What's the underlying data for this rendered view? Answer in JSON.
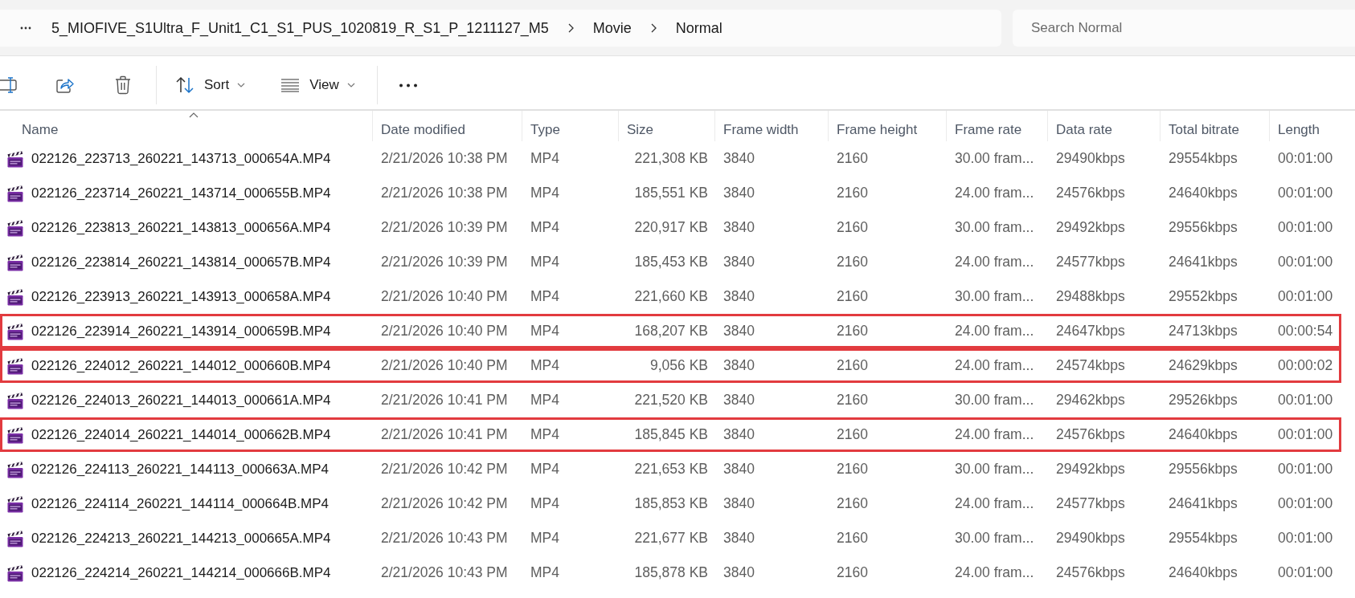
{
  "address_bar": {
    "breadcrumbs": [
      {
        "label": "5_MIOFIVE_S1Ultra_F_Unit1_C1_S1_PUS_1020819_R_S1_P_1211127_M5"
      },
      {
        "label": "Movie"
      },
      {
        "label": "Normal"
      }
    ]
  },
  "search": {
    "placeholder": "Search Normal"
  },
  "toolbar": {
    "buttons": [
      {
        "kind": "sort",
        "label": "Sort"
      },
      {
        "kind": "view",
        "label": "View"
      }
    ]
  },
  "table": {
    "columns": [
      {
        "label": "Name",
        "sorted": true
      },
      {
        "label": "Date modified",
        "sorted": false
      },
      {
        "label": "Type",
        "sorted": false
      },
      {
        "label": "Size",
        "sorted": false
      },
      {
        "label": "Frame width",
        "sorted": false
      },
      {
        "label": "Frame height",
        "sorted": false
      },
      {
        "label": "Frame rate",
        "sorted": false
      },
      {
        "label": "Data rate",
        "sorted": false
      },
      {
        "label": "Total bitrate",
        "sorted": false
      },
      {
        "label": "Length",
        "sorted": false
      }
    ],
    "rows": [
      {
        "cells": [
          "022126_223713_260221_143713_000654A.MP4",
          "2/21/2026 10:38 PM",
          "MP4",
          "221,308 KB",
          "3840",
          "2160",
          "30.00 fram...",
          "29490kbps",
          "29554kbps",
          "00:01:00"
        ],
        "outlined": false
      },
      {
        "cells": [
          "022126_223714_260221_143714_000655B.MP4",
          "2/21/2026 10:38 PM",
          "MP4",
          "185,551 KB",
          "3840",
          "2160",
          "24.00 fram...",
          "24576kbps",
          "24640kbps",
          "00:01:00"
        ],
        "outlined": false
      },
      {
        "cells": [
          "022126_223813_260221_143813_000656A.MP4",
          "2/21/2026 10:39 PM",
          "MP4",
          "220,917 KB",
          "3840",
          "2160",
          "30.00 fram...",
          "29492kbps",
          "29556kbps",
          "00:01:00"
        ],
        "outlined": false
      },
      {
        "cells": [
          "022126_223814_260221_143814_000657B.MP4",
          "2/21/2026 10:39 PM",
          "MP4",
          "185,453 KB",
          "3840",
          "2160",
          "24.00 fram...",
          "24577kbps",
          "24641kbps",
          "00:01:00"
        ],
        "outlined": false
      },
      {
        "cells": [
          "022126_223913_260221_143913_000658A.MP4",
          "2/21/2026 10:40 PM",
          "MP4",
          "221,660 KB",
          "3840",
          "2160",
          "30.00 fram...",
          "29488kbps",
          "29552kbps",
          "00:01:00"
        ],
        "outlined": false
      },
      {
        "cells": [
          "022126_223914_260221_143914_000659B.MP4",
          "2/21/2026 10:40 PM",
          "MP4",
          "168,207 KB",
          "3840",
          "2160",
          "24.00 fram...",
          "24647kbps",
          "24713kbps",
          "00:00:54"
        ],
        "outlined": true
      },
      {
        "cells": [
          "022126_224012_260221_144012_000660B.MP4",
          "2/21/2026 10:40 PM",
          "MP4",
          "9,056 KB",
          "3840",
          "2160",
          "24.00 fram...",
          "24574kbps",
          "24629kbps",
          "00:00:02"
        ],
        "outlined": true
      },
      {
        "cells": [
          "022126_224013_260221_144013_000661A.MP4",
          "2/21/2026 10:41 PM",
          "MP4",
          "221,520 KB",
          "3840",
          "2160",
          "30.00 fram...",
          "29462kbps",
          "29526kbps",
          "00:01:00"
        ],
        "outlined": false
      },
      {
        "cells": [
          "022126_224014_260221_144014_000662B.MP4",
          "2/21/2026 10:41 PM",
          "MP4",
          "185,845 KB",
          "3840",
          "2160",
          "24.00 fram...",
          "24576kbps",
          "24640kbps",
          "00:01:00"
        ],
        "outlined": true
      },
      {
        "cells": [
          "022126_224113_260221_144113_000663A.MP4",
          "2/21/2026 10:42 PM",
          "MP4",
          "221,653 KB",
          "3840",
          "2160",
          "30.00 fram...",
          "29492kbps",
          "29556kbps",
          "00:01:00"
        ],
        "outlined": false
      },
      {
        "cells": [
          "022126_224114_260221_144114_000664B.MP4",
          "2/21/2026 10:42 PM",
          "MP4",
          "185,853 KB",
          "3840",
          "2160",
          "24.00 fram...",
          "24577kbps",
          "24641kbps",
          "00:01:00"
        ],
        "outlined": false
      },
      {
        "cells": [
          "022126_224213_260221_144213_000665A.MP4",
          "2/21/2026 10:43 PM",
          "MP4",
          "221,677 KB",
          "3840",
          "2160",
          "30.00 fram...",
          "29490kbps",
          "29554kbps",
          "00:01:00"
        ],
        "outlined": false
      },
      {
        "cells": [
          "022126_224214_260221_144214_000666B.MP4",
          "2/21/2026 10:43 PM",
          "MP4",
          "185,878 KB",
          "3840",
          "2160",
          "24.00 fram...",
          "24576kbps",
          "24640kbps",
          "00:01:00"
        ],
        "outlined": false
      }
    ]
  }
}
